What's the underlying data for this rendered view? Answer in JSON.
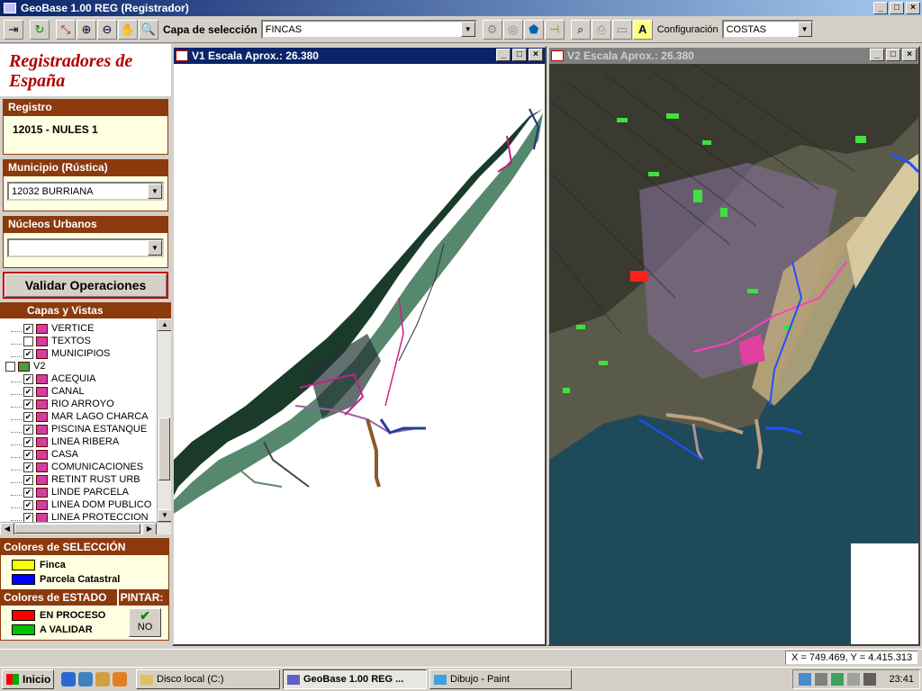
{
  "app": {
    "title": "GeoBase 1.00 REG (Registrador)"
  },
  "toolbar": {
    "capa_label": "Capa de selección",
    "capa_value": "FINCAS",
    "config_label": "Configuración",
    "config_value": "COSTAS"
  },
  "brand": {
    "line1": "Registradores de",
    "line2": "España"
  },
  "registro": {
    "header": "Registro",
    "value": "12015 - NULES 1"
  },
  "municipio": {
    "header": "Municipio (Rústica)",
    "value": "12032 BURRIANA"
  },
  "nucleos": {
    "header": "Núcleos Urbanos",
    "value": ""
  },
  "validar_label": "Validar Operaciones",
  "capas": {
    "header": "Capas y Vistas",
    "rows": [
      {
        "label": "VERTICE",
        "checked": "✔"
      },
      {
        "label": "TEXTOS",
        "checked": ""
      },
      {
        "label": "MUNICIPIOS",
        "checked": "✔"
      },
      {
        "label": "V2",
        "checked": ""
      },
      {
        "label": "ACEQUIA",
        "checked": "✔"
      },
      {
        "label": "CANAL",
        "checked": "✔"
      },
      {
        "label": "RIO ARROYO",
        "checked": "✔"
      },
      {
        "label": "MAR LAGO CHARCA",
        "checked": "✔"
      },
      {
        "label": "PISCINA ESTANQUE",
        "checked": "✔"
      },
      {
        "label": "LINEA RIBERA",
        "checked": "✔"
      },
      {
        "label": "CASA",
        "checked": "✔"
      },
      {
        "label": "COMUNICACIONES",
        "checked": "✔"
      },
      {
        "label": "RETINT RUST URB",
        "checked": "✔"
      },
      {
        "label": "LINDE PARCELA",
        "checked": "✔"
      },
      {
        "label": "LINEA DOM PUBLICO",
        "checked": "✔"
      },
      {
        "label": "LINEA PROTECCION",
        "checked": "✔"
      }
    ]
  },
  "seleccion": {
    "header": "Colores de SELECCIÓN",
    "items": [
      {
        "label": "Finca",
        "color": "#ffff00"
      },
      {
        "label": "Parcela Catastral",
        "color": "#0000ff"
      }
    ]
  },
  "estado": {
    "header": "Colores de ESTADO",
    "pintar_header": "PINTAR:",
    "pintar_value": "NO",
    "items": [
      {
        "label": "EN PROCESO",
        "color": "#ff0000"
      },
      {
        "label": "A VALIDAR",
        "color": "#00c000"
      }
    ]
  },
  "v1": {
    "title": "V1 Escala Aprox.: 26.380"
  },
  "v2": {
    "title": "V2 Escala Aprox.: 26.380"
  },
  "status": {
    "coords": "X = 749.469, Y = 4.415.313"
  },
  "taskbar": {
    "start": "Inicio",
    "tasks": [
      "Disco local (C:)",
      "GeoBase 1.00 REG ...",
      "Dibujo - Paint"
    ],
    "clock": "23:41"
  }
}
